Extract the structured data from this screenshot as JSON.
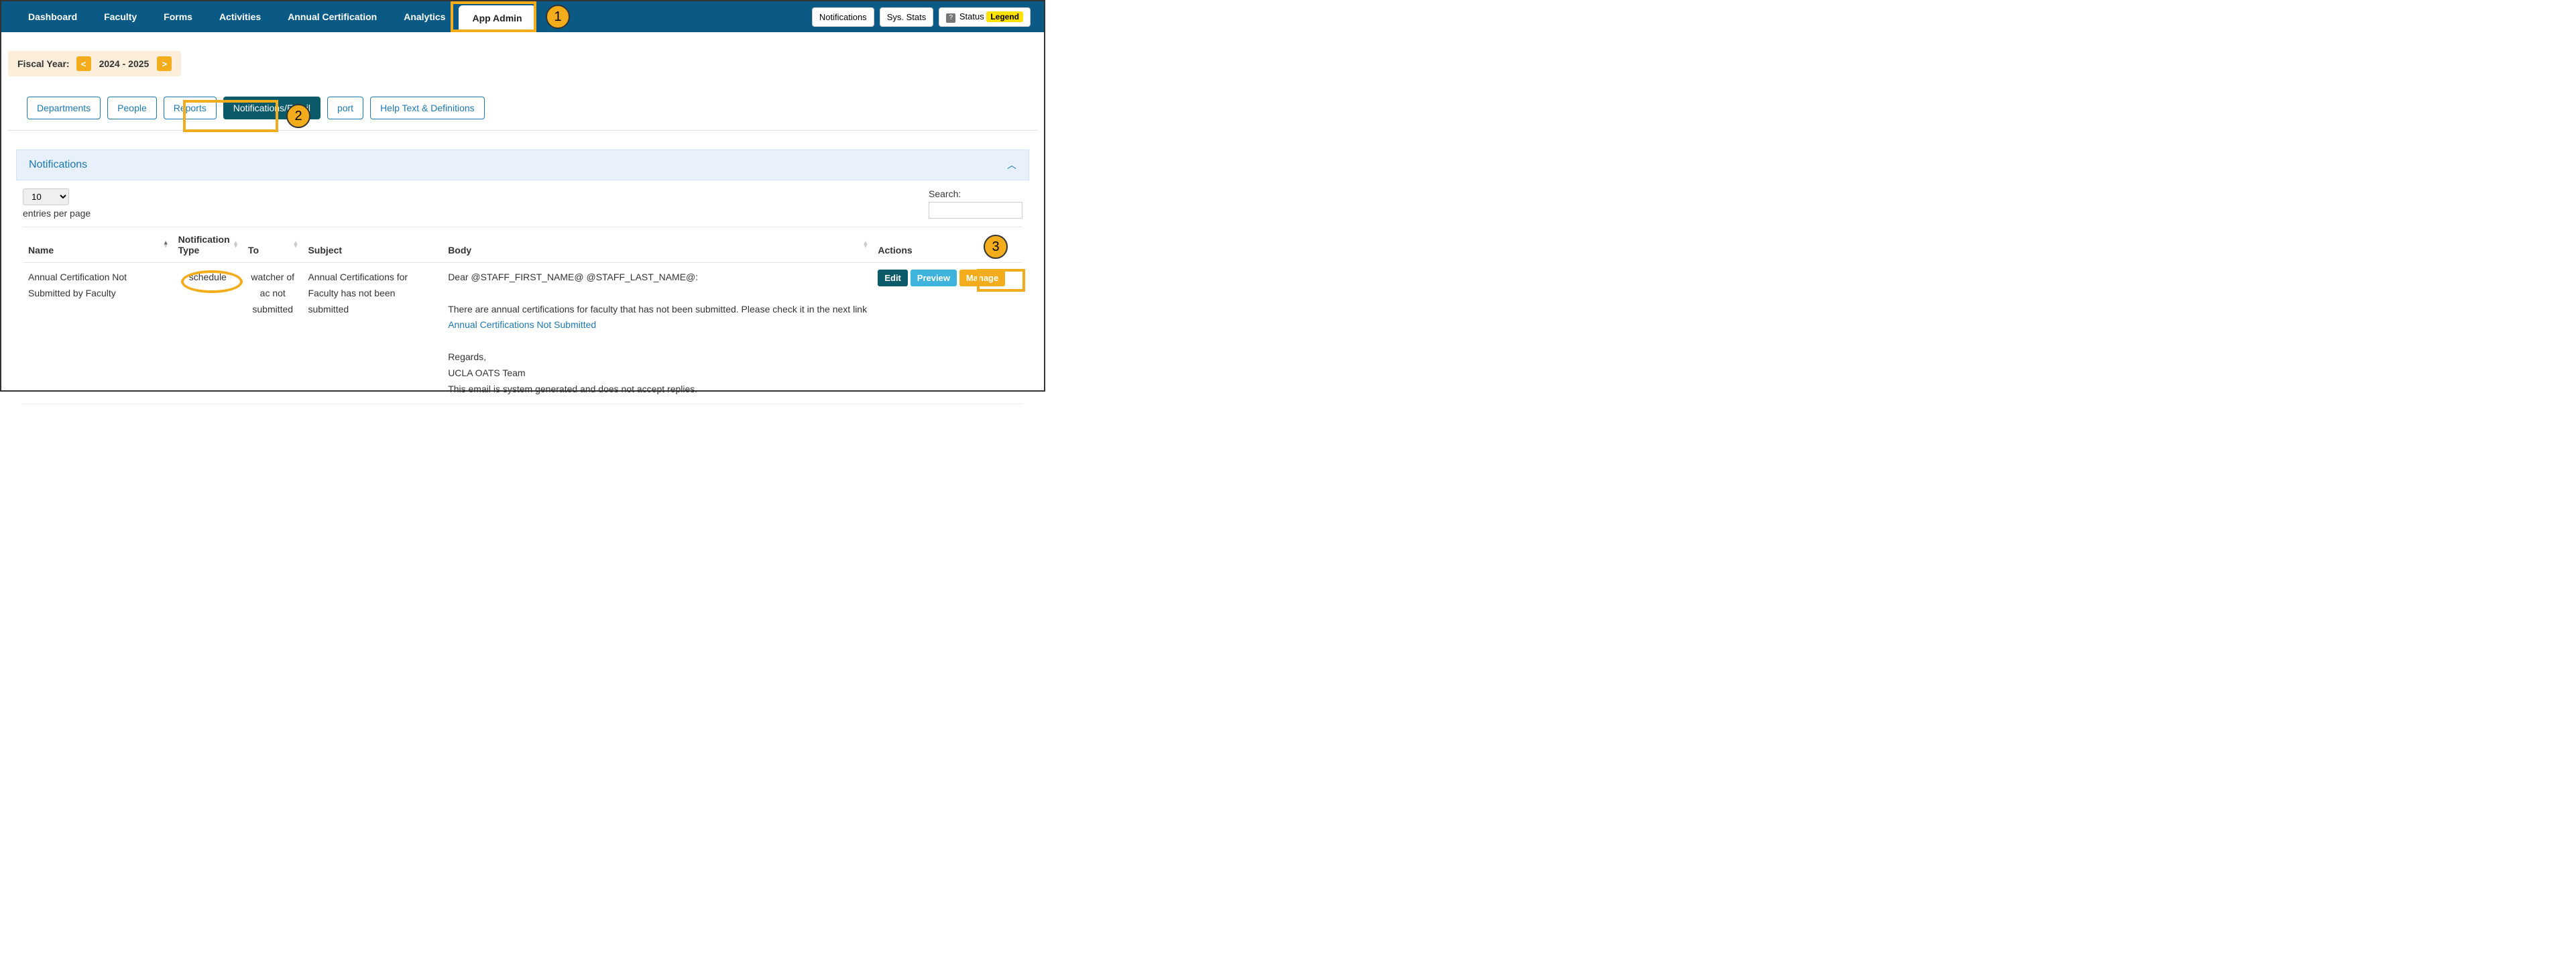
{
  "nav": {
    "items": [
      {
        "label": "Dashboard"
      },
      {
        "label": "Faculty"
      },
      {
        "label": "Forms"
      },
      {
        "label": "Activities"
      },
      {
        "label": "Annual Certification"
      },
      {
        "label": "Analytics"
      },
      {
        "label": "App Admin",
        "active": true
      }
    ],
    "right": {
      "notifications": "Notifications",
      "sysstats": "Sys. Stats",
      "status": "Status",
      "legend": "Legend"
    }
  },
  "fiscal": {
    "label": "Fiscal Year:",
    "prev": "<",
    "year": "2024 - 2025",
    "next": ">"
  },
  "subtabs": [
    {
      "label": "Departments"
    },
    {
      "label": "People"
    },
    {
      "label": "Reports"
    },
    {
      "label": "Notifications/Email",
      "active": true
    },
    {
      "label": "port"
    },
    {
      "label": "Help Text & Definitions"
    }
  ],
  "panel": {
    "title": "Notifications"
  },
  "pager": {
    "selected": "10",
    "entries_label": "entries per page",
    "search_label": "Search:"
  },
  "columns": {
    "name": "Name",
    "type": "Notification Type",
    "to": "To",
    "subject": "Subject",
    "body": "Body",
    "actions": "Actions"
  },
  "row": {
    "name": "Annual Certification Not Submitted by Faculty",
    "type": "schedule",
    "to": "watcher of ac not submitted",
    "subject": "Annual Certifications for Faculty has not been submitted",
    "body_line1": "Dear @STAFF_FIRST_NAME@ @STAFF_LAST_NAME@:",
    "body_line2a": "There are annual certifications for faculty that has not been submitted. Please check it in the next link ",
    "body_link": "Annual Certifications Not Submitted",
    "body_line3": "Regards,",
    "body_line4": "UCLA OATS Team",
    "body_line5": "This email is system generated and does not accept replies.",
    "actions": {
      "edit": "Edit",
      "preview": "Preview",
      "manage": "Manage"
    }
  },
  "annotations": {
    "one": "1",
    "two": "2",
    "three": "3"
  }
}
